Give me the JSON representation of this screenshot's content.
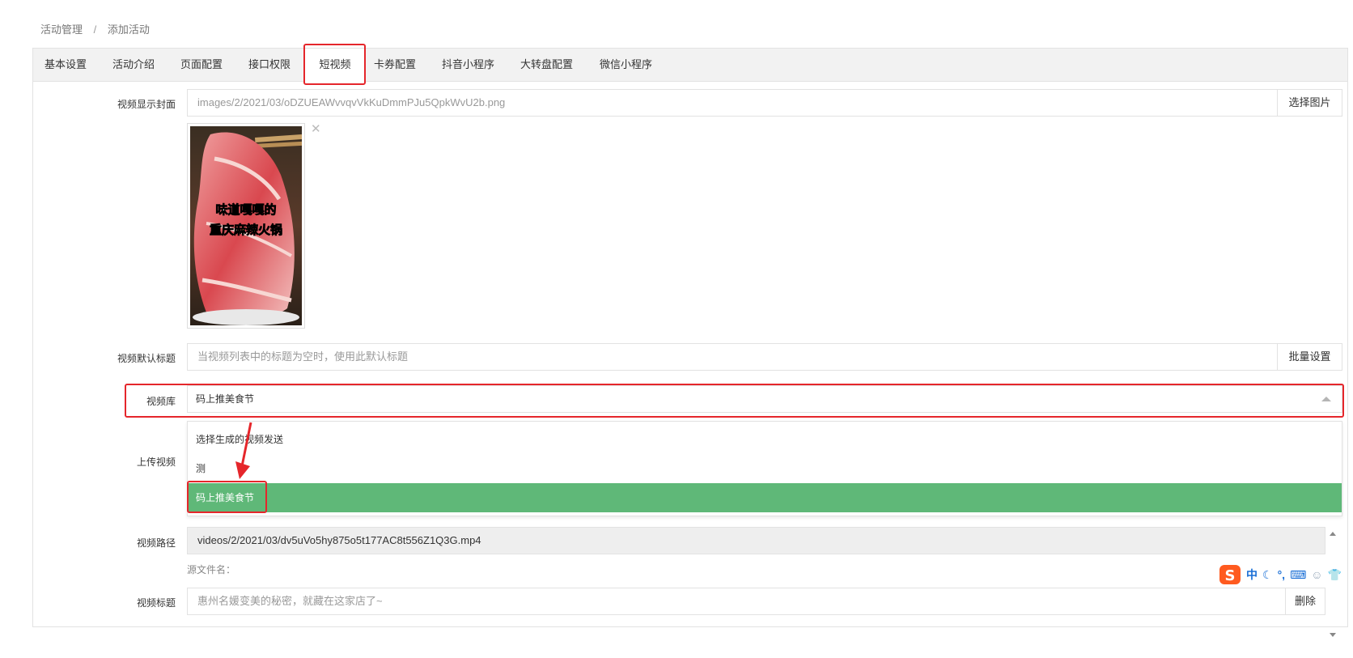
{
  "breadcrumb": {
    "parent": "活动管理",
    "separator": "/",
    "current": "添加活动"
  },
  "tabs": [
    {
      "label": "基本设置"
    },
    {
      "label": "活动介绍"
    },
    {
      "label": "页面配置"
    },
    {
      "label": "接口权限"
    },
    {
      "label": "短视频",
      "active": true
    },
    {
      "label": "卡券配置"
    },
    {
      "label": "抖音小程序"
    },
    {
      "label": "大转盘配置"
    },
    {
      "label": "微信小程序"
    }
  ],
  "form": {
    "cover": {
      "label": "视频显示封面",
      "value": "images/2/2021/03/oDZUEAWvvqvVkKuDmmPJu5QpkWvU2b.png",
      "button": "选择图片",
      "thumb_text_1": "味道嘎嘎的",
      "thumb_text_2": "重庆麻辣火锅"
    },
    "default_title": {
      "label": "视频默认标题",
      "placeholder": "当视频列表中的标题为空时，使用此默认标题",
      "button": "批量设置"
    },
    "library": {
      "label": "视频库",
      "value": "码上推美食节",
      "options": [
        "选择生成的视频发送",
        "测",
        "码上推美食节"
      ],
      "selected_index": 2
    },
    "upload": {
      "label": "上传视频"
    },
    "path": {
      "label": "视频路径",
      "value": "videos/2/2021/03/dv5uVo5hy875o5t177AC8t556Z1Q3G.mp4",
      "source_label": "源文件名："
    },
    "video_title": {
      "label": "视频标题",
      "placeholder": "惠州名媛变美的秘密，就藏在这家店了~",
      "button": "删除"
    }
  },
  "ime": {
    "mode": "中"
  },
  "colors": {
    "highlight": "#e5262b",
    "selected": "#5fb878"
  }
}
